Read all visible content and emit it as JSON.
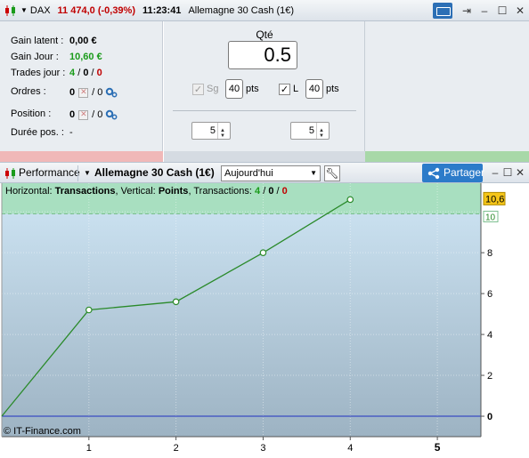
{
  "title_bar": {
    "instrument": "DAX",
    "price": "11 474,0 (-0,39%)",
    "time": "11:23:41",
    "product": "Allemagne 30 Cash (1€)"
  },
  "left_panel": {
    "gain_latent_label": "Gain latent :",
    "gain_latent_value": "0,00 €",
    "gain_jour_label": "Gain Jour :",
    "gain_jour_value": "10,60 €",
    "trades_label": "Trades jour :",
    "trades_total": "4",
    "trades_win": "0",
    "trades_loss": "0",
    "ordres_label": "Ordres :",
    "ordres_value_a": "0",
    "ordres_value_b": "/ 0",
    "position_label": "Position :",
    "position_value_a": "0",
    "position_value_b": "/ 0",
    "duree_label": "Durée pos. :",
    "duree_value": "-"
  },
  "order_panel": {
    "qty_label": "Qté",
    "qty_value": "0.5",
    "sg_label": "Sg",
    "sg_value": "40",
    "sg_unit": "pts",
    "l_label": "L",
    "l_value": "40",
    "l_unit": "pts",
    "spin_left": "5",
    "spin_right": "5"
  },
  "chart_header": {
    "performance_label": "Performance",
    "product": "Allemagne 30 Cash (1€)",
    "period": "Aujourd'hui",
    "share_label": "Partager"
  },
  "chart_info": {
    "horizontal_label": "Horizontal:",
    "horizontal_value": "Transactions",
    "vertical_label": ", Vertical:",
    "vertical_value": "Points",
    "transactions_label": ", Transactions:",
    "tx_total": "4",
    "tx_win": "0",
    "tx_loss": "0"
  },
  "footer": "© IT-Finance.com",
  "chart_data": {
    "type": "line",
    "x": [
      0,
      1,
      2,
      3,
      4
    ],
    "series": [
      {
        "values": [
          0,
          5.2,
          5.6,
          8.0,
          10.6
        ]
      }
    ],
    "xlim": [
      0,
      5.5
    ],
    "ylim": [
      -1,
      11.4
    ],
    "x_ticks": [
      "1",
      "2",
      "3",
      "4",
      "5"
    ],
    "y_ticks": [
      "0",
      "2",
      "4",
      "6",
      "8",
      "10"
    ],
    "current_value_label": "10,6",
    "reference_label": "10",
    "reference_value": 9.9,
    "colors": {
      "line": "#2a8a2a",
      "zero_line": "#2030c0",
      "top_band": "#a8dfc0",
      "badge": "#f5c518"
    }
  }
}
